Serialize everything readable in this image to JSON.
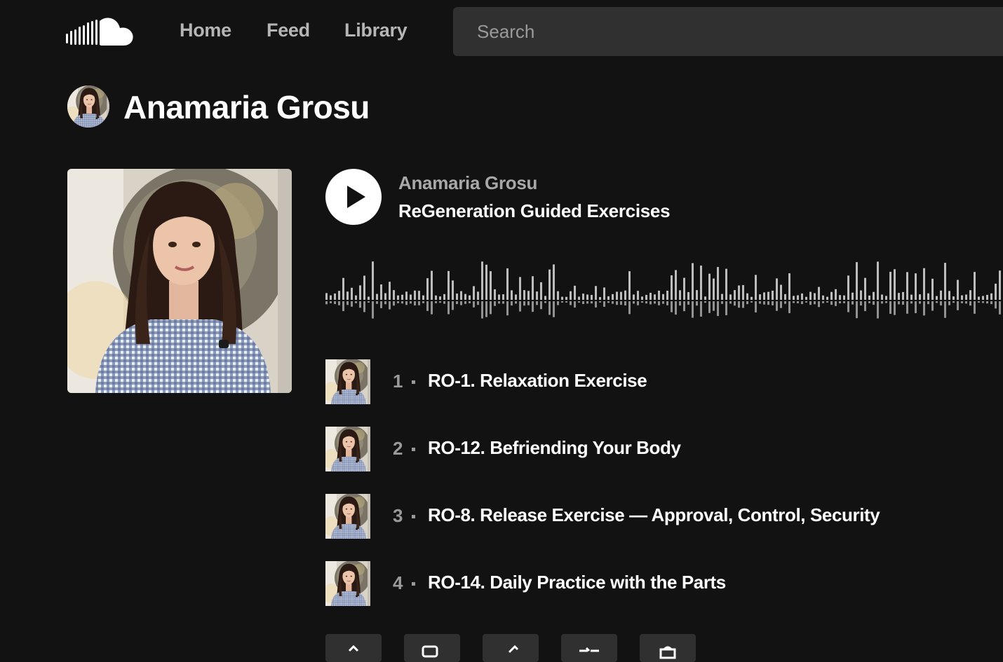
{
  "header": {
    "logo_icon": "soundcloud-cloud-icon",
    "nav": {
      "home": "Home",
      "feed": "Feed",
      "library": "Library"
    },
    "search": {
      "placeholder": "Search",
      "value": ""
    }
  },
  "profile": {
    "name": "Anamaria Grosu"
  },
  "player": {
    "artist": "Anamaria Grosu",
    "title": "ReGeneration Guided Exercises",
    "play_icon": "play-icon"
  },
  "tracks": [
    {
      "number": "1",
      "title": "RO-1. Relaxation Exercise"
    },
    {
      "number": "2",
      "title": "RO-12. Befriending Your Body"
    },
    {
      "number": "3",
      "title": "RO-8. Release Exercise — Approval, Control, Security"
    },
    {
      "number": "4",
      "title": "RO-14. Daily Practice with the Parts"
    }
  ],
  "actions": [
    {
      "icon": "share-icon"
    },
    {
      "icon": "copy-link-icon"
    },
    {
      "icon": "edit-icon"
    },
    {
      "icon": "queue-icon"
    },
    {
      "icon": "buy-icon"
    }
  ],
  "colors": {
    "background": "#121212",
    "nav_text": "#b5b5b5",
    "search_bg": "#303030",
    "muted_text": "#9a9a9a",
    "waveform": "#bdbdbd"
  }
}
